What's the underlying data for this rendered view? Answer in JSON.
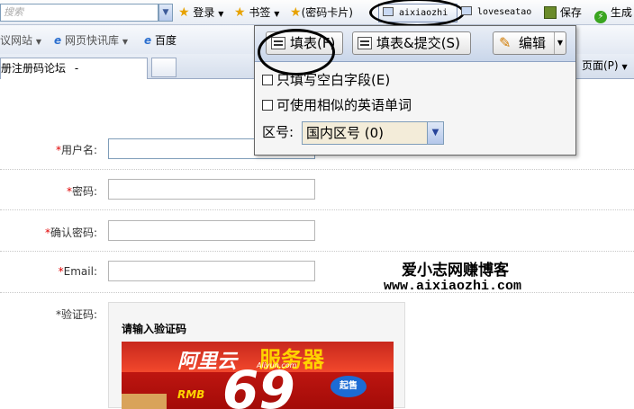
{
  "browser": {
    "search_placeholder": "搜索",
    "toolbar_items": {
      "login": "登录",
      "bookmarks": "书签",
      "password_card": "(密码卡片)",
      "tab_aixiaozhi": "aixiaozhi",
      "tab_loveseatao": "loveseatao",
      "save": "保存",
      "generate": "生成"
    },
    "links": {
      "item1": "议网站",
      "item2": "网页快讯库",
      "item3": "百度"
    },
    "page_tab": "册注册码论坛",
    "page_menu": "页面(P)"
  },
  "popup": {
    "fill_button": "填表(F)",
    "fill_submit_button": "填表&提交(S)",
    "edit_button": "编辑",
    "only_blank_label": "只填写空白字段(E)",
    "similar_words_label": "可使用相似的英语单词",
    "region_label": "区号:",
    "region_value": "国内区号 (0)"
  },
  "form": {
    "username_label": "用户名:",
    "password_label": "密码:",
    "confirm_password_label": "确认密码:",
    "email_label": "Email:",
    "captcha_label": "验证码:",
    "required_mark": "*",
    "captcha_title": "请输入验证码"
  },
  "ad": {
    "brand": "阿里云",
    "slogan": "服务器",
    "domain": "Aliyun.com",
    "price": "69",
    "currency": "RMB",
    "badge": "起售"
  },
  "watermark": {
    "title": "爱小志网赚博客",
    "url": "www.aixiaozhi.com"
  },
  "colors": {
    "required": "#e00000",
    "ad_red": "#d31e17",
    "ad_yellow": "#ffd200"
  }
}
